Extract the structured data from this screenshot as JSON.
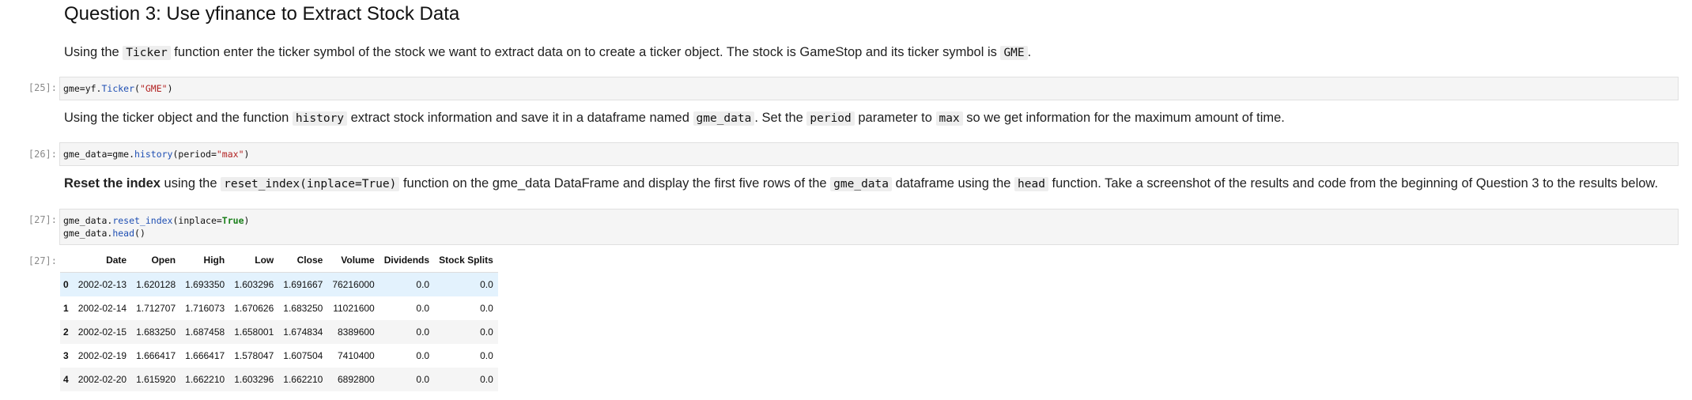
{
  "heading": "Question 3: Use yfinance to Extract Stock Data",
  "md1": {
    "t1": "Using the ",
    "c1": "Ticker",
    "t2": " function enter the ticker symbol of the stock we want to extract data on to create a ticker object. The stock is GameStop and its ticker symbol is ",
    "c2": "GME",
    "t3": "."
  },
  "cell25": {
    "prompt": "[25]:",
    "a": "gme=yf.",
    "fn": "Ticker",
    "b": "(",
    "str": "\"GME\"",
    "c": ")"
  },
  "md2": {
    "t1": "Using the ticker object and the function ",
    "c1": "history",
    "t2": " extract stock information and save it in a dataframe named ",
    "c2": "gme_data",
    "t3": ". Set the ",
    "c3": "period",
    "t4": " parameter to ",
    "c4": "max",
    "t5": " so we get information for the maximum amount of time."
  },
  "cell26": {
    "prompt": "[26]:",
    "a": "gme_data=gme.",
    "fn": "history",
    "b": "(period=",
    "str": "\"max\"",
    "c": ")"
  },
  "md3": {
    "bold": "Reset the index",
    "t1": " using the ",
    "c1": "reset_index(inplace=True)",
    "t2": " function on the gme_data DataFrame and display the first five rows of the ",
    "c2": "gme_data",
    "t3": " dataframe using the ",
    "c3": "head",
    "t4": " function. Take a screenshot of the results and code from the beginning of Question 3 to the results below."
  },
  "cell27": {
    "prompt": "[27]:",
    "l1a": "gme_data.",
    "l1fn": "reset_index",
    "l1b": "(inplace=",
    "l1true": "True",
    "l1c": ")",
    "l2a": "gme_data.",
    "l2fn": "head",
    "l2b": "()"
  },
  "output27": {
    "prompt": "[27]:",
    "columns": [
      "",
      "Date",
      "Open",
      "High",
      "Low",
      "Close",
      "Volume",
      "Dividends",
      "Stock Splits"
    ],
    "rows": [
      [
        "0",
        "2002-02-13",
        "1.620128",
        "1.693350",
        "1.603296",
        "1.691667",
        "76216000",
        "0.0",
        "0.0"
      ],
      [
        "1",
        "2002-02-14",
        "1.712707",
        "1.716073",
        "1.670626",
        "1.683250",
        "11021600",
        "0.0",
        "0.0"
      ],
      [
        "2",
        "2002-02-15",
        "1.683250",
        "1.687458",
        "1.658001",
        "1.674834",
        "8389600",
        "0.0",
        "0.0"
      ],
      [
        "3",
        "2002-02-19",
        "1.666417",
        "1.666417",
        "1.578047",
        "1.607504",
        "7410400",
        "0.0",
        "0.0"
      ],
      [
        "4",
        "2002-02-20",
        "1.615920",
        "1.662210",
        "1.603296",
        "1.662210",
        "6892800",
        "0.0",
        "0.0"
      ]
    ]
  }
}
